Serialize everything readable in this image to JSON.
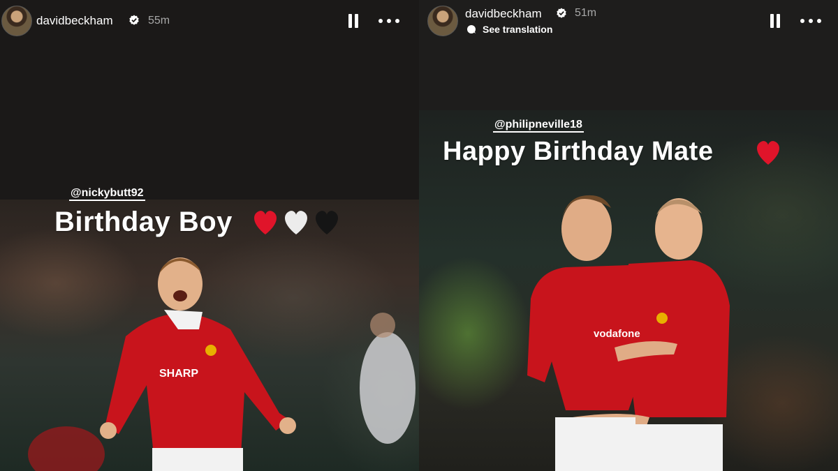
{
  "stories": [
    {
      "username": "davidbeckham",
      "time": "55m",
      "mention": "@nickybutt92",
      "caption": "Birthday Boy",
      "emojis": [
        "❤️",
        "🤍",
        "🖤"
      ],
      "jersey_text": "SHARP"
    },
    {
      "username": "davidbeckham",
      "time": "51m",
      "translate_label": "See translation",
      "mention": "@philipneville18",
      "caption": "Happy Birthday Mate",
      "emojis": [
        "❤️"
      ],
      "jersey_text": "vodafone"
    }
  ],
  "colors": {
    "background": "#1b1918",
    "text": "#ffffff",
    "time": "#a8a8a8",
    "kit_red": "#c8141c",
    "heart_red": "#e0142a"
  },
  "icons": [
    "verified-badge-icon",
    "pause-icon",
    "more-options-icon",
    "translate-icon"
  ]
}
